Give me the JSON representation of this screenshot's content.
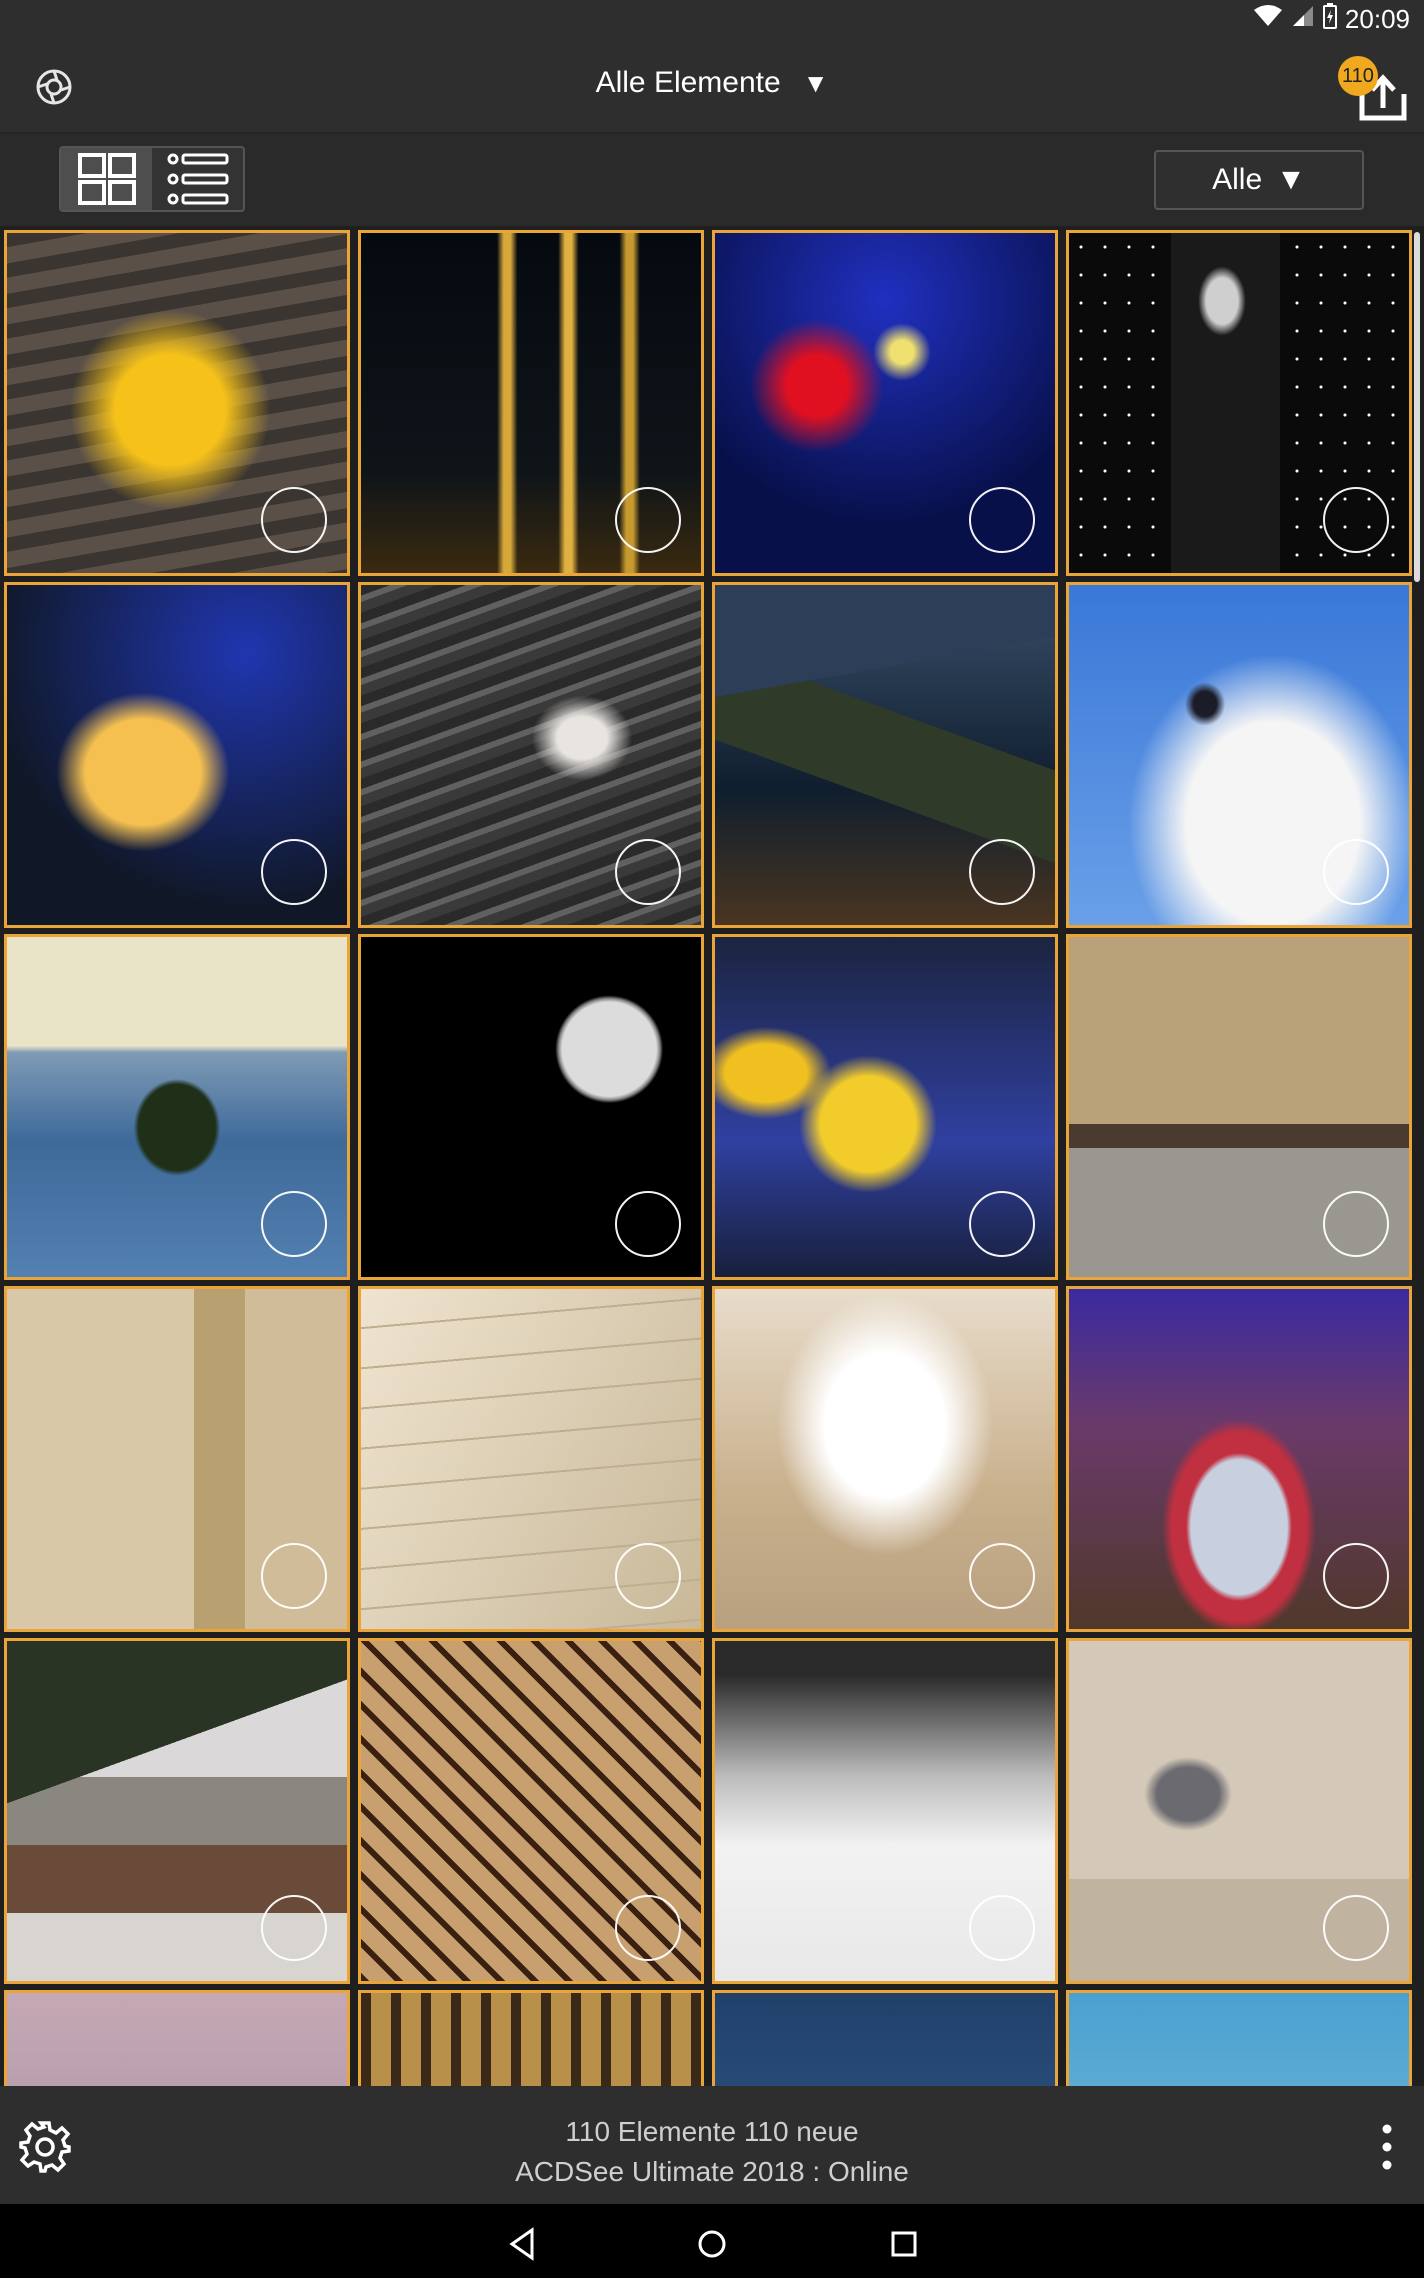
{
  "status_bar": {
    "time": "20:09",
    "icons": [
      "wifi-icon",
      "cell-signal-icon",
      "battery-icon"
    ]
  },
  "header": {
    "title": "Alle Elemente",
    "dropdown_caret": "▼",
    "export_badge_count": "110",
    "icons": [
      "app-logo-icon",
      "export-icon"
    ]
  },
  "toolbar": {
    "views": [
      "grid-view",
      "list-view"
    ],
    "active_view": "grid-view",
    "filter": {
      "label": "Alle",
      "caret": "▼"
    }
  },
  "grid": {
    "tiles": [
      {
        "subject": "yellow maple leaf on wood"
      },
      {
        "subject": "bottles in dark"
      },
      {
        "subject": "light painting on blue"
      },
      {
        "subject": "mannequin in window"
      },
      {
        "subject": "yellow tulip on blue"
      },
      {
        "subject": "seagull over water"
      },
      {
        "subject": "rocky coastline"
      },
      {
        "subject": "bird in cloudy sky"
      },
      {
        "subject": "island on sea"
      },
      {
        "subject": "full moon"
      },
      {
        "subject": "yellow tulips"
      },
      {
        "subject": "street with vintage cars"
      },
      {
        "subject": "beige interior"
      },
      {
        "subject": "open book"
      },
      {
        "subject": "bright hallway"
      },
      {
        "subject": "painted face mural"
      },
      {
        "subject": "snowy cabin"
      },
      {
        "subject": "chocolate cake slice"
      },
      {
        "subject": "snowy field"
      },
      {
        "subject": "woman on beach"
      },
      {
        "subject": "pink sky"
      },
      {
        "subject": "building facade"
      },
      {
        "subject": "blue sky"
      },
      {
        "subject": "sky horizon"
      }
    ]
  },
  "bottom_bar": {
    "line1": "110 Elemente  110 neue",
    "line2": "ACDSee Ultimate 2018 : Online",
    "icons": [
      "settings-gear-icon",
      "more-vert-icon"
    ]
  },
  "nav_bar": {
    "icons": [
      "back-icon",
      "home-icon",
      "recents-icon"
    ]
  }
}
